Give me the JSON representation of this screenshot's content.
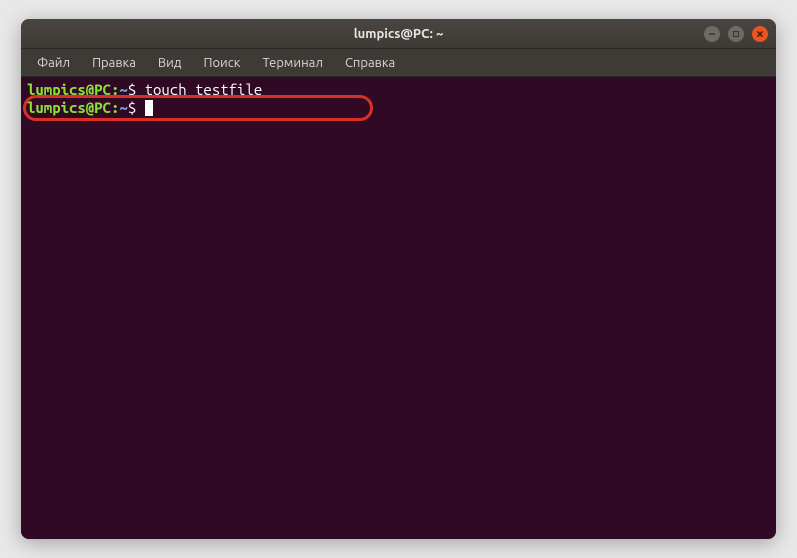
{
  "window": {
    "title": "lumpics@PC: ~"
  },
  "menubar": {
    "items": [
      "Файл",
      "Правка",
      "Вид",
      "Поиск",
      "Терминал",
      "Справка"
    ]
  },
  "terminal": {
    "lines": [
      {
        "prompt_user_host": "lumpics@PC:",
        "prompt_path": "~",
        "prompt_symbol": "$",
        "command": "touch testfile"
      },
      {
        "prompt_user_host": "lumpics@PC:",
        "prompt_path": "~",
        "prompt_symbol": "$",
        "command": ""
      }
    ]
  },
  "annotation": {
    "highlight_color": "#d93025"
  }
}
